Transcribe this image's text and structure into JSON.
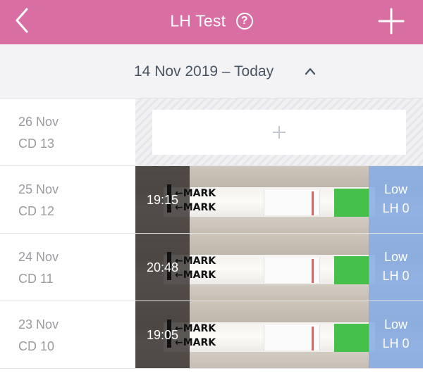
{
  "header": {
    "title": "LH Test",
    "help_label": "?"
  },
  "range": {
    "label": "14 Nov 2019 – Today"
  },
  "colors": {
    "header_bg": "#d96ea3",
    "status_bg": "#84ace6",
    "strip_green": "#45c04a"
  },
  "icons": {
    "back": "chevron-left-icon",
    "help": "question-circle-icon",
    "add": "plus-icon",
    "collapse": "chevron-up-icon"
  },
  "rows": [
    {
      "date": "26 Nov",
      "cycle_day": "CD 13",
      "empty": true
    },
    {
      "date": "25 Nov",
      "cycle_day": "CD 12",
      "time": "19:15",
      "mark_text": "MARK",
      "result": "Low",
      "lh": "LH 0"
    },
    {
      "date": "24 Nov",
      "cycle_day": "CD 11",
      "time": "20:48",
      "mark_text": "MARK",
      "result": "Low",
      "lh": "LH 0"
    },
    {
      "date": "23 Nov",
      "cycle_day": "CD 10",
      "time": "19:05",
      "mark_text": "MARK",
      "result": "Low",
      "lh": "LH 0"
    }
  ]
}
